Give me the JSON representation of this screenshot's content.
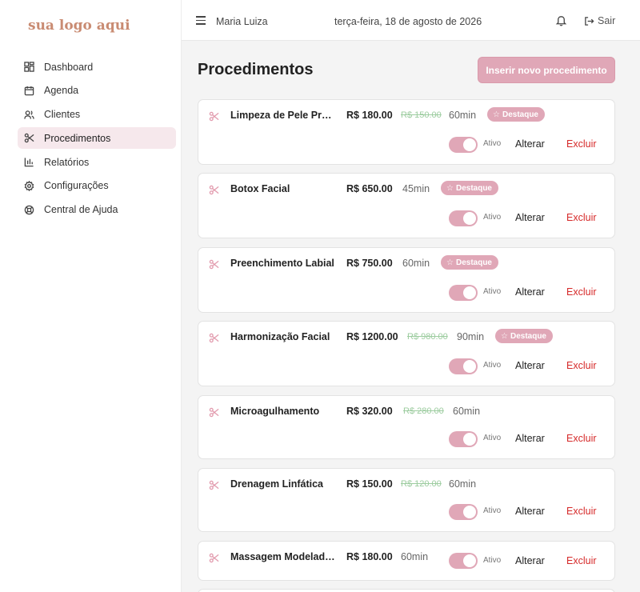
{
  "logo": "sua logo aqui",
  "sidebar": {
    "items": [
      {
        "label": "Dashboard",
        "icon": "dashboard-icon"
      },
      {
        "label": "Agenda",
        "icon": "calendar-icon"
      },
      {
        "label": "Clientes",
        "icon": "users-icon"
      },
      {
        "label": "Procedimentos",
        "icon": "scissors-icon",
        "active": true
      },
      {
        "label": "Relatórios",
        "icon": "bar-chart-icon"
      },
      {
        "label": "Configurações",
        "icon": "gear-icon"
      },
      {
        "label": "Central de Ajuda",
        "icon": "lifebuoy-icon"
      }
    ]
  },
  "header": {
    "user": "Maria Luiza",
    "date": "terça-feira, 18 de agosto de 2026",
    "logout": "Sair"
  },
  "page": {
    "title": "Procedimentos",
    "add_button": "Inserir novo procedimento"
  },
  "labels": {
    "badge": "Destaque",
    "active": "Ativo",
    "edit": "Alterar",
    "delete": "Excluir"
  },
  "procedures": [
    {
      "name": "Limpeza de Pele Prof...",
      "price": "R$ 180.00",
      "old_price": "R$ 150.00",
      "duration": "60min",
      "featured": true,
      "active": true
    },
    {
      "name": "Botox Facial",
      "price": "R$ 650.00",
      "old_price": "",
      "duration": "45min",
      "featured": true,
      "active": true
    },
    {
      "name": "Preenchimento Labial",
      "price": "R$ 750.00",
      "old_price": "",
      "duration": "60min",
      "featured": true,
      "active": true
    },
    {
      "name": "Harmonização Facial",
      "price": "R$ 1200.00",
      "old_price": "R$ 980.00",
      "duration": "90min",
      "featured": true,
      "active": true
    },
    {
      "name": "Microagulhamento",
      "price": "R$ 320.00",
      "old_price": "R$ 280.00",
      "duration": "60min",
      "featured": false,
      "active": true
    },
    {
      "name": "Drenagem Linfática",
      "price": "R$ 150.00",
      "old_price": "R$ 120.00",
      "duration": "60min",
      "featured": false,
      "active": true
    },
    {
      "name": "Massagem Modeladora",
      "price": "R$ 180.00",
      "old_price": "",
      "duration": "60min",
      "featured": false,
      "active": true
    }
  ],
  "colors": {
    "accent": "#e0a7b7",
    "logo": "#c98b72",
    "danger": "#d62a2a",
    "old_price": "#9ccc9f",
    "active_nav": "#f6e8ec"
  }
}
